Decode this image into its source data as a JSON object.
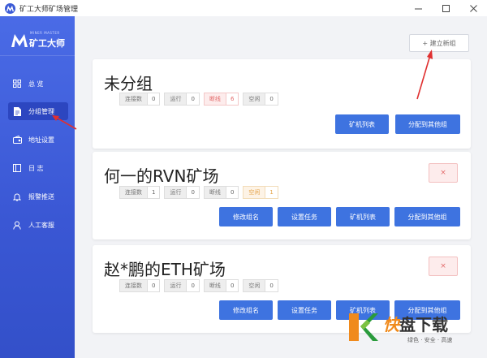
{
  "window": {
    "title": "矿工大师矿场管理"
  },
  "brand": {
    "sub": "MINER MASTER",
    "name": "矿工大师"
  },
  "nav": {
    "items": [
      {
        "label": "总 览",
        "icon": "grid-icon"
      },
      {
        "label": "分组管理",
        "icon": "document-icon",
        "active": true
      },
      {
        "label": "地址设置",
        "icon": "wallet-icon"
      },
      {
        "label": "日 志",
        "icon": "log-icon"
      },
      {
        "label": "报警推送",
        "icon": "bell-icon"
      },
      {
        "label": "人工客服",
        "icon": "person-icon"
      }
    ]
  },
  "toolbar": {
    "new_group_label": "+ 建立新组"
  },
  "groups": [
    {
      "title": "未分组",
      "stats": [
        {
          "label": "连接数",
          "value": "0"
        },
        {
          "label": "运行",
          "value": "0"
        },
        {
          "label": "断线",
          "value": "6"
        },
        {
          "label": "空闲",
          "value": "0"
        }
      ],
      "buttons": [
        "矿机列表",
        "分配到其他组"
      ]
    },
    {
      "title": "何一的RVN矿场",
      "stats": [
        {
          "label": "连接数",
          "value": "1"
        },
        {
          "label": "运行",
          "value": "0"
        },
        {
          "label": "断线",
          "value": "0"
        },
        {
          "label": "空闲",
          "value": "1"
        }
      ],
      "buttons": [
        "修改组名",
        "设置任务",
        "矿机列表",
        "分配到其他组"
      ],
      "close_label": "×"
    },
    {
      "title": "赵*鹏的ETH矿场",
      "stats": [
        {
          "label": "连接数",
          "value": "0"
        },
        {
          "label": "运行",
          "value": "0"
        },
        {
          "label": "断线",
          "value": "0"
        },
        {
          "label": "空闲",
          "value": "0"
        }
      ],
      "buttons": [
        "修改组名",
        "设置任务",
        "矿机列表",
        "分配到其他组"
      ],
      "close_label": "×"
    }
  ],
  "watermark": {
    "kuai": "快",
    "main": "盘下载",
    "sub": "绿色 · 安全 · 高速"
  },
  "colors": {
    "sidebar": "#3a57d4",
    "primary_button": "#3e73e0",
    "danger": "#e36a6a",
    "warning": "#e5a44a",
    "arrow": "#e03030"
  }
}
